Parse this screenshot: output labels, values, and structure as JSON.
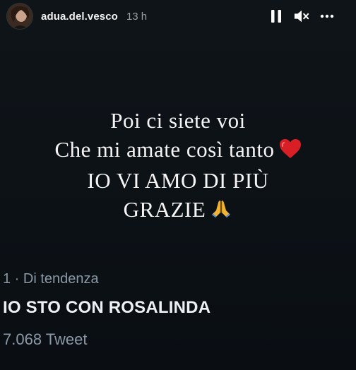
{
  "header": {
    "username": "adua.del.vesco",
    "time": "13 h",
    "pause_icon": "pause-icon",
    "mute_icon": "speaker-muted-icon",
    "more_icon": "more-horizontal-icon"
  },
  "story": {
    "lines": [
      "Poi ci siete voi",
      "Che mi amate così tanto",
      "IO VI AMO DI PIÙ",
      "GRAZIE"
    ],
    "emojis": [
      "red-heart-icon",
      "praying-hands-icon"
    ]
  },
  "trend": {
    "category": "1 · Di tendenza",
    "title": "IO STO CON ROSALINDA",
    "count": "7.068 Tweet"
  },
  "colors": {
    "background": "#0c1116",
    "text": "#f5f5f5",
    "muted": "#8b98a5",
    "heart": "#d81f26",
    "hands": "#f2b233"
  }
}
